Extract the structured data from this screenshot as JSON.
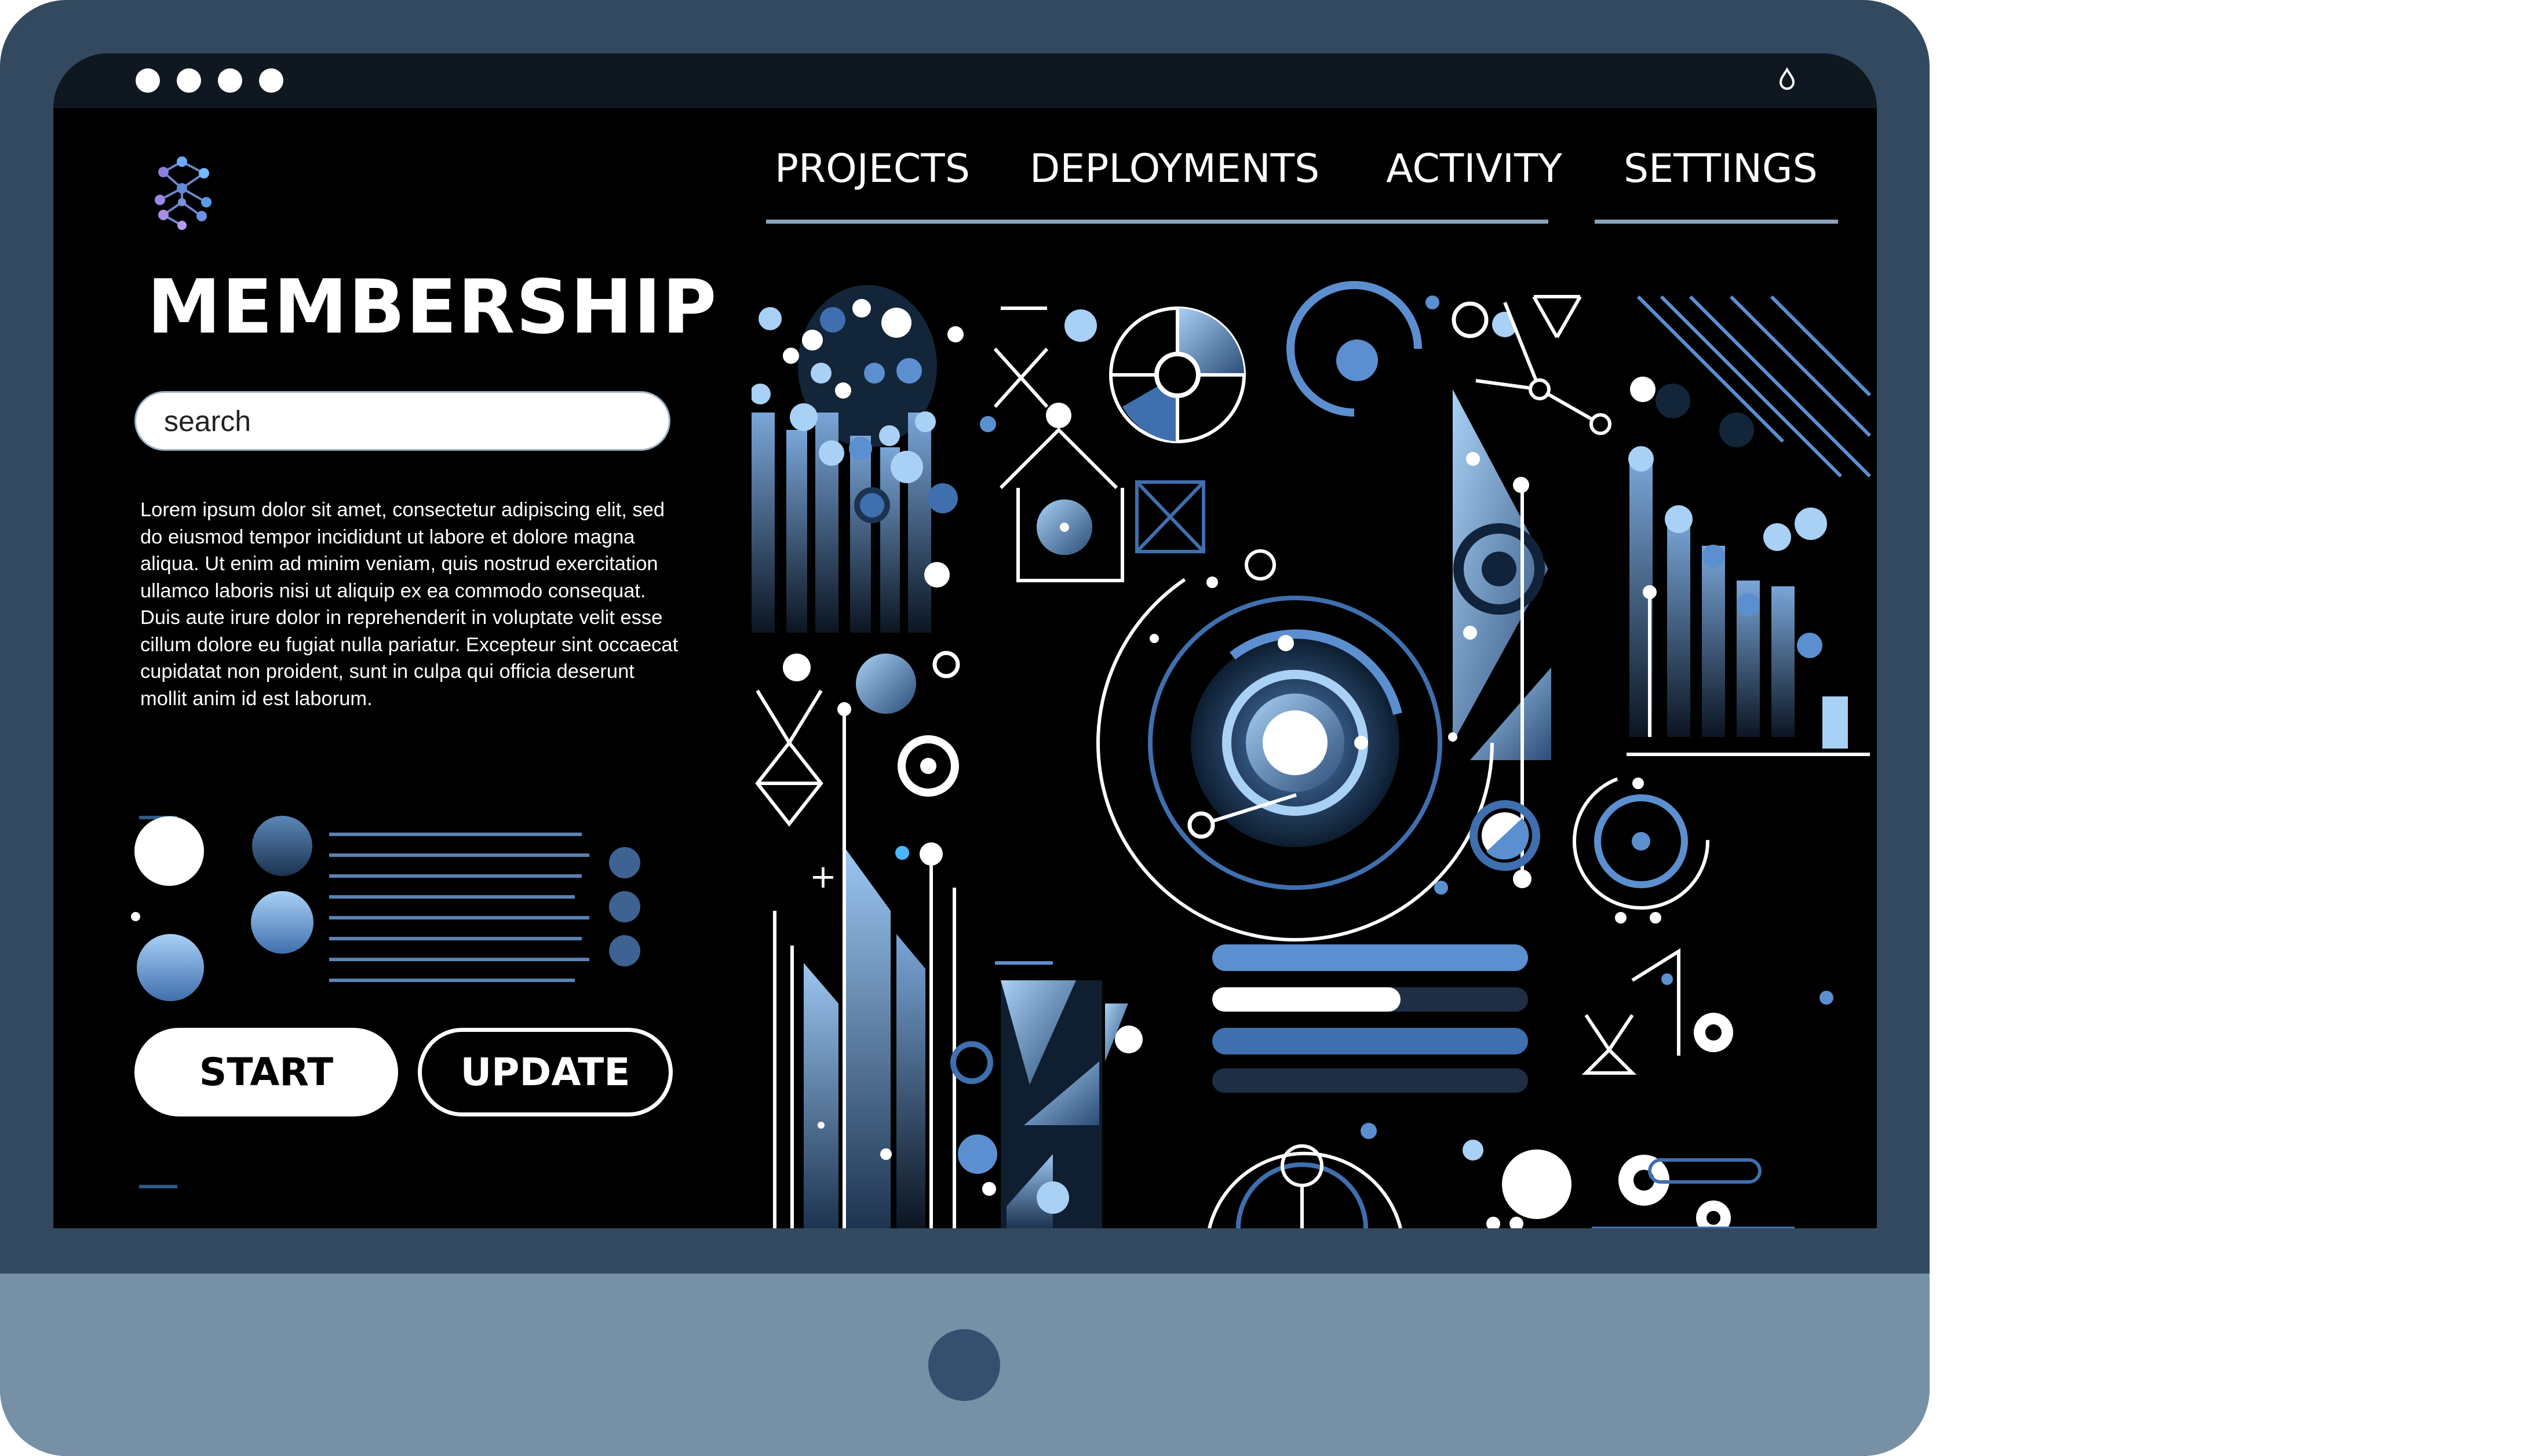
{
  "window": {
    "controls": [
      "dot",
      "dot",
      "dot",
      "dot"
    ],
    "indicator_icon": "drop-icon"
  },
  "brand": {
    "logo_icon": "network-icon",
    "title": "MEMBERSHIP"
  },
  "search": {
    "placeholder": "search",
    "value": ""
  },
  "intro": {
    "text": "Lorem ipsum dolor sit amet, consectetur adipiscing elit, sed do eiusmod tempor incididunt ut labore et dolore magna aliqua. Ut enim ad minim veniam, quis nostrud exercitation ullamco laboris nisi ut aliquip ex ea commodo consequat. Duis aute irure dolor in reprehenderit in voluptate velit esse cillum dolore eu fugiat nulla pariatur. Excepteur sint occaecat cupidatat non proident, sunt in culpa qui officia deserunt mollit anim id est laborum."
  },
  "actions": {
    "start_label": "START",
    "update_label": "UPDATE"
  },
  "nav": {
    "items": [
      {
        "label": "PROJECTS"
      },
      {
        "label": "DEPLOYMENTS"
      },
      {
        "label": "ACTIVITY"
      },
      {
        "label": "SETTINGS"
      }
    ]
  },
  "colors": {
    "bezel": "#33495f",
    "chin": "#7690a6",
    "screen": "#000000",
    "accent": "#5b8fd0",
    "accent_light": "#a9d0f5"
  }
}
